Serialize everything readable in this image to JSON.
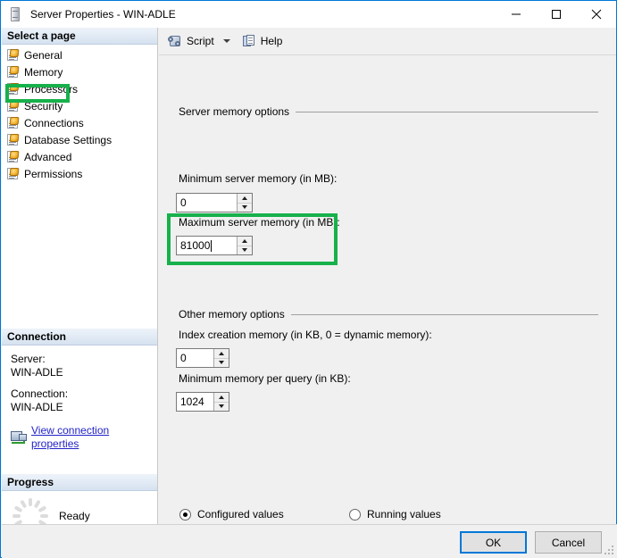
{
  "window": {
    "title": "Server Properties - WIN-ADLE",
    "icon": "server-icon",
    "minimize": "—",
    "maximize": "□",
    "close": "✕"
  },
  "sidebar": {
    "header": "Select a page",
    "items": [
      {
        "label": "General"
      },
      {
        "label": "Memory"
      },
      {
        "label": "Processors"
      },
      {
        "label": "Security"
      },
      {
        "label": "Connections"
      },
      {
        "label": "Database Settings"
      },
      {
        "label": "Advanced"
      },
      {
        "label": "Permissions"
      }
    ],
    "selected": "Memory",
    "connection": {
      "header": "Connection",
      "server_label": "Server:",
      "server_value": "WIN-ADLE",
      "connection_label": "Connection:",
      "connection_value": "WIN-ADLE",
      "view_link": "View connection properties"
    },
    "progress": {
      "header": "Progress",
      "status": "Ready"
    }
  },
  "toolbar": {
    "script_label": "Script",
    "help_label": "Help"
  },
  "main": {
    "server_memory_section": "Server memory options",
    "min_server_memory_label": "Minimum server memory (in MB):",
    "min_server_memory_value": "0",
    "max_server_memory_label": "Maximum server memory (in MB):",
    "max_server_memory_value": "81000",
    "other_memory_section": "Other memory options",
    "index_creation_label": "Index creation memory (in KB, 0 = dynamic memory):",
    "index_creation_value": "0",
    "min_memory_query_label": "Minimum memory per query (in KB):",
    "min_memory_query_value": "1024",
    "configured_values_label": "Configured values",
    "running_values_label": "Running values",
    "selected_values_mode": "Configured values"
  },
  "footer": {
    "ok_label": "OK",
    "cancel_label": "Cancel"
  },
  "highlights": {
    "color": "#17b14b",
    "targets": [
      "Memory",
      "Maximum server memory (in MB):"
    ]
  }
}
